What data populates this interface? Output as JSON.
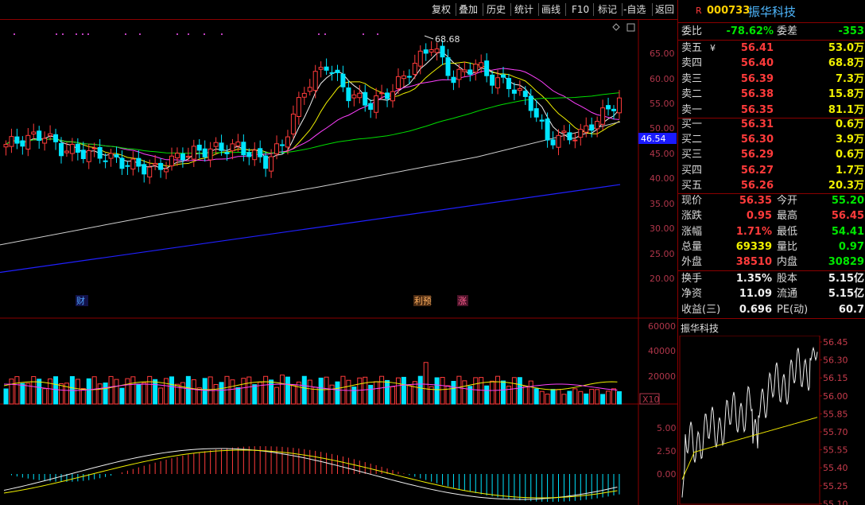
{
  "toolbar": {
    "buttons": [
      "复权",
      "叠加",
      "历史",
      "统计",
      "画线",
      "F10",
      "标记",
      "-自选",
      "返回"
    ]
  },
  "stock": {
    "code": "000733",
    "name": "振华科技",
    "badge": "R"
  },
  "main_chart": {
    "high_marker": "68.68",
    "price_axis": [
      "65.00",
      "60.00",
      "55.00",
      "50.00",
      "45.00",
      "40.00",
      "35.00",
      "30.00",
      "25.00",
      "20.00"
    ],
    "current_tag": "46.54",
    "event_tags": [
      "财",
      "利预",
      "涨"
    ]
  },
  "volume_chart": {
    "axis": [
      "60000",
      "40000",
      "20000"
    ],
    "unit": "X10"
  },
  "macd_chart": {
    "axis": [
      "5.00",
      "2.50",
      "0.00"
    ]
  },
  "orderbook": {
    "weibi_label": "委比",
    "weibi_value": "-78.62%",
    "weicha_label": "委差",
    "weicha_value": "-353",
    "asks": [
      {
        "label": "卖五",
        "price": "56.41",
        "vol": "53.0万"
      },
      {
        "label": "卖四",
        "price": "56.40",
        "vol": "68.8万"
      },
      {
        "label": "卖三",
        "price": "56.39",
        "vol": "7.3万"
      },
      {
        "label": "卖二",
        "price": "56.38",
        "vol": "15.8万"
      },
      {
        "label": "卖一",
        "price": "56.35",
        "vol": "81.1万"
      }
    ],
    "bids": [
      {
        "label": "买一",
        "price": "56.31",
        "vol": "0.6万"
      },
      {
        "label": "买二",
        "price": "56.30",
        "vol": "3.9万"
      },
      {
        "label": "买三",
        "price": "56.29",
        "vol": "0.6万"
      },
      {
        "label": "买四",
        "price": "56.27",
        "vol": "1.7万"
      },
      {
        "label": "买五",
        "price": "56.26",
        "vol": "20.3万"
      }
    ],
    "yen_mark": "¥"
  },
  "quote": [
    {
      "l1": "现价",
      "v1": "56.35",
      "c1": "red",
      "l2": "今开",
      "v2": "55.20",
      "c2": "green"
    },
    {
      "l1": "涨跌",
      "v1": "0.95",
      "c1": "red",
      "l2": "最高",
      "v2": "56.45",
      "c2": "red"
    },
    {
      "l1": "涨幅",
      "v1": "1.71%",
      "c1": "red",
      "l2": "最低",
      "v2": "54.41",
      "c2": "green"
    },
    {
      "l1": "总量",
      "v1": "69339",
      "c1": "yellow",
      "l2": "量比",
      "v2": "0.97",
      "c2": "green"
    },
    {
      "l1": "外盘",
      "v1": "38510",
      "c1": "red",
      "l2": "内盘",
      "v2": "30829",
      "c2": "green"
    }
  ],
  "fundamentals": [
    {
      "l1": "换手",
      "v1": "1.35%",
      "l2": "股本",
      "v2": "5.15亿"
    },
    {
      "l1": "净资",
      "v1": "11.09",
      "l2": "流通",
      "v2": "5.15亿"
    },
    {
      "l1": "收益(三)",
      "v1": "0.696",
      "l2": "PE(动)",
      "v2": "60.7"
    }
  ],
  "mini_chart": {
    "title": "振华科技",
    "axis": [
      "56.45",
      "56.30",
      "56.15",
      "56.00",
      "55.85",
      "55.70",
      "55.55",
      "55.40",
      "55.25",
      "55.10"
    ]
  }
}
